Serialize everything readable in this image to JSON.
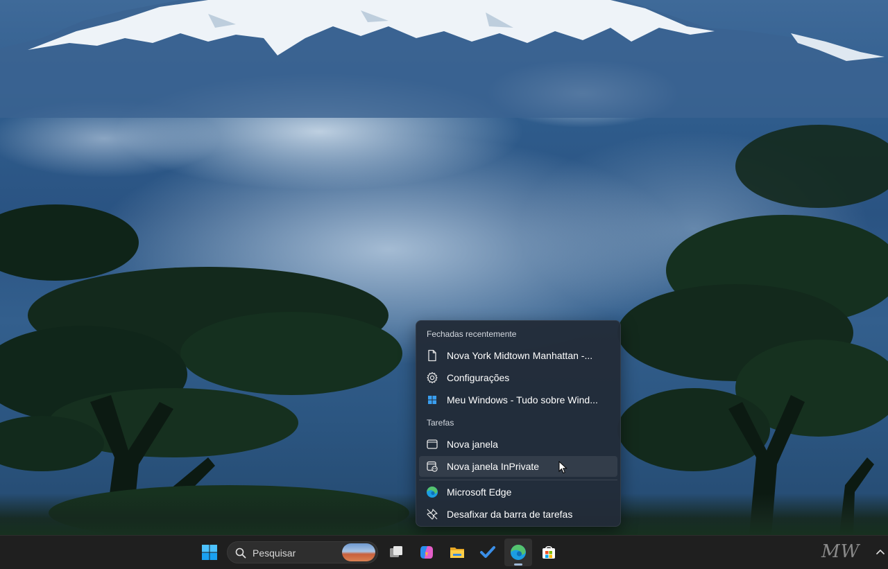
{
  "jump_list": {
    "recent_header": "Fechadas recentemente",
    "recent_items": [
      {
        "label": "Nova York Midtown Manhattan -...",
        "icon": "document-icon"
      },
      {
        "label": "Configurações",
        "icon": "gear-icon"
      },
      {
        "label": "Meu Windows - Tudo sobre Wind...",
        "icon": "windows-logo-icon"
      }
    ],
    "tasks_header": "Tarefas",
    "task_items": [
      {
        "label": "Nova janela",
        "icon": "window-icon"
      },
      {
        "label": "Nova janela InPrivate",
        "icon": "inprivate-window-icon",
        "hovered": true
      }
    ],
    "app_name": "Microsoft Edge",
    "unpin_label": "Desafixar da barra de tarefas"
  },
  "taskbar": {
    "search_placeholder": "Pesquisar",
    "watermark": "MW",
    "buttons": [
      "start-button",
      "task-view-button",
      "copilot-button",
      "file-explorer-button",
      "todo-button",
      "edge-button",
      "microsoft-store-button"
    ],
    "active_button": "edge-button"
  },
  "colors": {
    "taskbar_bg": "#1f1f1f",
    "menu_bg": "#222c38",
    "edge_blue": "#1b9de2",
    "edge_green": "#54c36e"
  }
}
